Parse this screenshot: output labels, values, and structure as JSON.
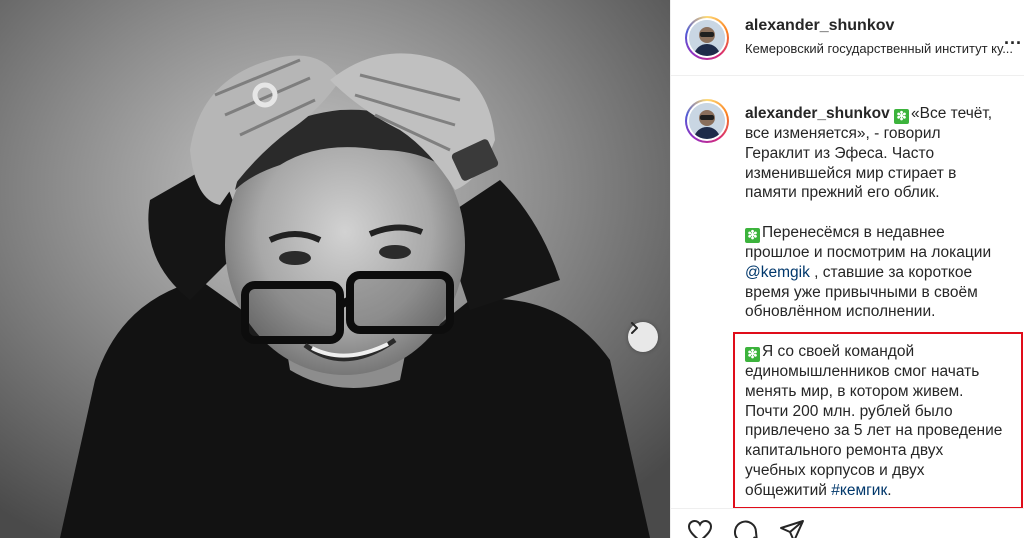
{
  "post": {
    "username": "alexander_shunkov",
    "location": "Кемеровский государственный институт ку...",
    "more_label": "..."
  },
  "caption": {
    "username": "alexander_shunkov",
    "paragraph1": "«Все течёт, все изменяется», - говорил Гераклит из Эфеса. Часто изменившейся мир стирает в памяти прежний его облик.",
    "paragraph2_before": "Перенесёмся в недавнее прошлое и посмотрим на локации ",
    "paragraph2_mention": "@kemgik",
    "paragraph2_after": " , ставшие за короткое время уже привычными в своём обновлённом исполнении.",
    "paragraph3": "Я со своей командой единомышленников смог начать менять мир, в котором живем. Почти 200 млн. рублей было привлечено за 5 лет на проведение капитального ремонта двух учебных корпусов и двух общежитий ",
    "paragraph3_hashtag": "#кемгик",
    "paragraph3_end": ".",
    "emoji_symbol": "❇"
  },
  "icons": {
    "like": "heart-icon",
    "comment": "comment-icon",
    "share": "paper-plane-icon",
    "next": "chevron-right-icon"
  },
  "colors": {
    "highlight": "#e00d1a",
    "link": "#00376b",
    "emoji_bg": "#3cb33c"
  }
}
